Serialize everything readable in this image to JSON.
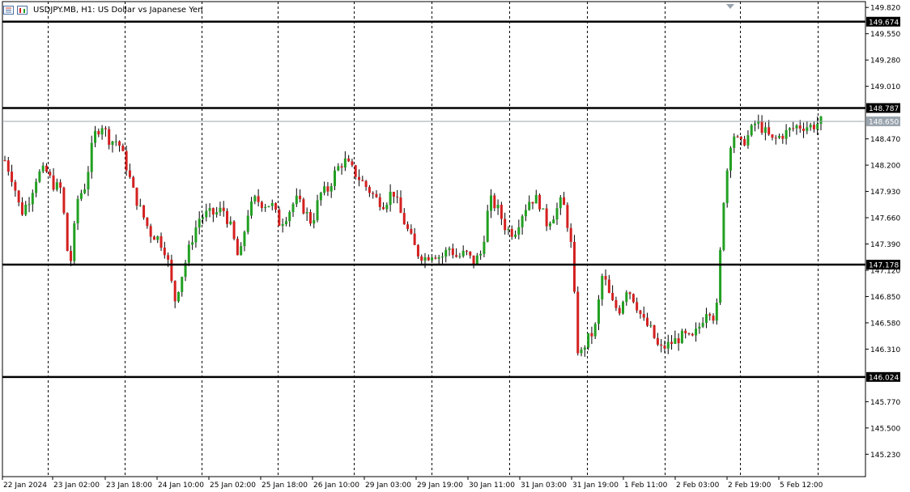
{
  "header": {
    "symbol": "USDJPY.MB",
    "timeframe": "H1:",
    "description": "US Dollar vs Japanese Yen",
    "icons": [
      "chart-list-icon",
      "chart-bars-icon"
    ]
  },
  "colors": {
    "bull": "#22a022",
    "bear": "#d42020",
    "wick": "#000000",
    "level_line": "#000000",
    "bid_line": "#9aa4ae",
    "bid_label_bg": "#9aa4ae",
    "level_label_bg": "#000000",
    "grid": "#000000"
  },
  "chart_data": {
    "type": "candlestick",
    "title": "USDJPY.MB, H1: US Dollar vs Japanese Yen",
    "ylim": [
      145.0,
      149.88
    ],
    "y_ticks": [
      "149.820",
      "149.550",
      "149.280",
      "149.010",
      "148.470",
      "148.200",
      "147.930",
      "147.660",
      "147.390",
      "147.120",
      "146.850",
      "146.580",
      "146.310",
      "145.770",
      "145.500",
      "145.230"
    ],
    "x_ticks": [
      "22 Jan 2024",
      "23 Jan 02:00",
      "23 Jan 18:00",
      "24 Jan 10:00",
      "25 Jan 02:00",
      "25 Jan 18:00",
      "26 Jan 10:00",
      "29 Jan 03:00",
      "29 Jan 19:00",
      "30 Jan 11:00",
      "31 Jan 03:00",
      "31 Jan 19:00",
      "1 Feb 11:00",
      "2 Feb 03:00",
      "2 Feb 19:00",
      "5 Feb 12:00"
    ],
    "vertical_grid": "dashed",
    "horizontal_levels": [
      {
        "label": "149.674",
        "value": 149.674
      },
      {
        "label": "148.787",
        "value": 148.787
      },
      {
        "label": "147.178",
        "value": 147.178
      },
      {
        "label": "146.024",
        "value": 146.024
      }
    ],
    "bid": {
      "label": "148.650",
      "value": 148.65
    },
    "candles_by_segment": [
      {
        "from": "22 Jan 2024",
        "bars": 14,
        "prices": [
          148.25,
          148.05,
          147.7,
          147.85,
          148.1,
          148.15,
          148.0
        ]
      },
      {
        "from": "23 Jan 02:00",
        "bars": 16,
        "prices": [
          147.95,
          147.1,
          147.85,
          148.0,
          148.5,
          148.62,
          148.45
        ]
      },
      {
        "from": "23 Jan 18:00",
        "bars": 16,
        "prices": [
          148.45,
          148.2,
          147.9,
          147.7,
          147.5,
          147.45
        ]
      },
      {
        "from": "24 Jan 10:00",
        "bars": 16,
        "prices": [
          147.3,
          146.8,
          147.1,
          147.4,
          147.65,
          147.7
        ]
      },
      {
        "from": "25 Jan 02:00",
        "bars": 16,
        "prices": [
          147.7,
          147.75,
          147.55,
          147.2,
          147.7,
          147.85,
          147.8
        ]
      },
      {
        "from": "25 Jan 18:00",
        "bars": 16,
        "prices": [
          147.8,
          147.6,
          147.7,
          147.85,
          147.75,
          147.6,
          147.9
        ]
      },
      {
        "from": "26 Jan 10:00",
        "bars": 16,
        "prices": [
          147.95,
          148.15,
          148.25,
          148.15,
          148.05,
          147.95,
          147.85
        ]
      },
      {
        "from": "29 Jan 03:00",
        "bars": 16,
        "prices": [
          147.8,
          147.95,
          147.7,
          147.5,
          147.3,
          147.25
        ]
      },
      {
        "from": "29 Jan 19:00",
        "bars": 16,
        "prices": [
          147.3,
          147.25,
          147.35,
          147.25,
          147.3,
          147.2
        ]
      },
      {
        "from": "30 Jan 11:00",
        "bars": 16,
        "prices": [
          147.3,
          147.85,
          147.75,
          147.55,
          147.5,
          147.7,
          147.85
        ]
      },
      {
        "from": "31 Jan 03:00",
        "bars": 16,
        "prices": [
          147.85,
          147.6,
          147.7,
          147.85,
          147.45,
          146.2,
          146.4
        ]
      },
      {
        "from": "31 Jan 19:00",
        "bars": 16,
        "prices": [
          146.5,
          147.1,
          146.8,
          146.7,
          146.95,
          146.8,
          146.6
        ]
      },
      {
        "from": "1 Feb 11:00",
        "bars": 16,
        "prices": [
          146.5,
          146.3,
          146.35,
          146.4,
          146.45,
          146.4,
          146.55
        ]
      },
      {
        "from": "2 Feb 03:00",
        "bars": 16,
        "prices": [
          146.75,
          146.6,
          147.9,
          148.55,
          148.4,
          148.5,
          148.65
        ]
      },
      {
        "from": "2 Feb 19:00",
        "bars": 16,
        "prices": [
          148.55,
          148.45,
          148.5,
          148.55,
          148.6,
          148.6
        ]
      },
      {
        "from": "5 Feb 12:00",
        "bars": 3,
        "prices": [
          148.6,
          148.65
        ]
      }
    ]
  }
}
